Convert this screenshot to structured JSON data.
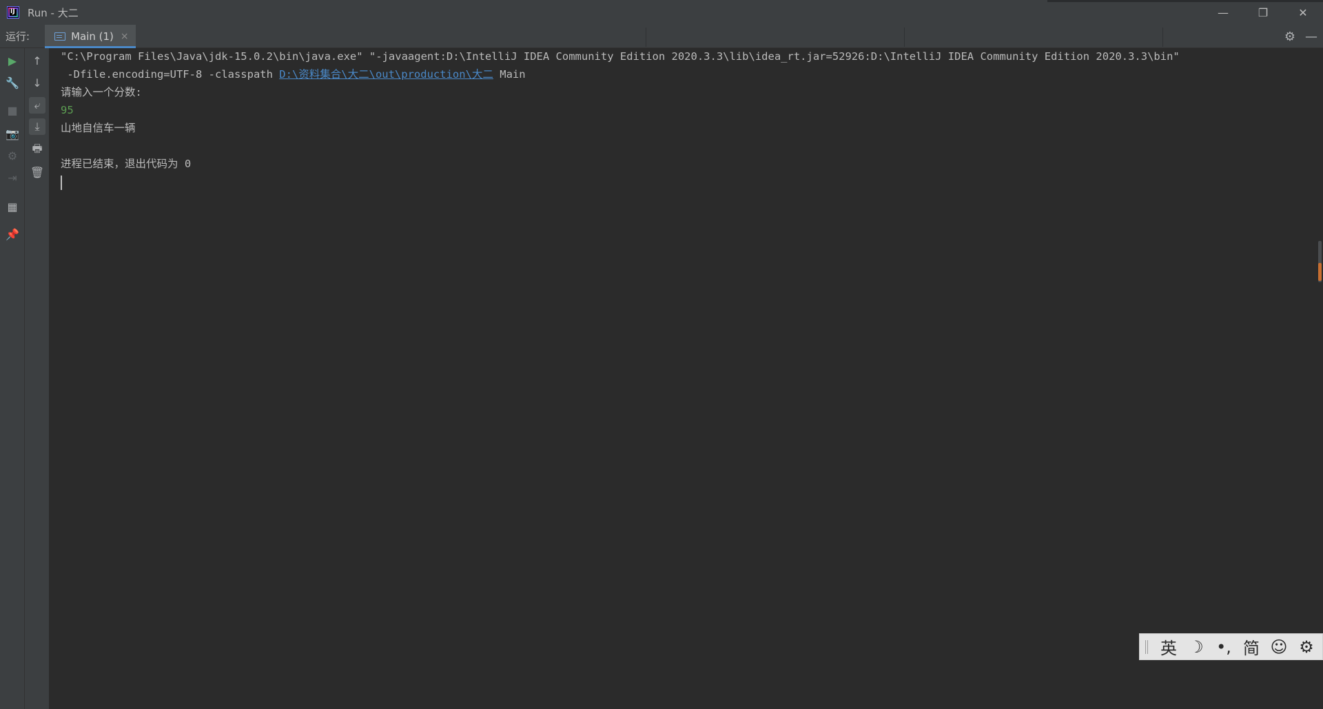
{
  "window": {
    "title": "Run - 大二",
    "logo_text": "IJ",
    "controls": {
      "minimize": "—",
      "restore": "❐",
      "close": "✕"
    }
  },
  "toolwindow": {
    "run_label": "运行:",
    "tab": {
      "label": "Main (1)",
      "close": "×"
    },
    "settings_icon": "⚙",
    "hide_icon": "—"
  },
  "left_toolbar": {
    "rerun": "▶",
    "wrench": "🔧",
    "stop": "■",
    "camera": "📷",
    "debug": "⚙",
    "exit": "⇥",
    "layout": "▦",
    "pin": "📌"
  },
  "second_toolbar": {
    "up": "↑",
    "down": "↓",
    "soft_wrap": "⤶",
    "scroll_end": "⤓",
    "print": "🖶",
    "trash": "🗑"
  },
  "console": {
    "line1": "\"C:\\Program Files\\Java\\jdk-15.0.2\\bin\\java.exe\" \"-javaagent:D:\\IntelliJ IDEA Community Edition 2020.3.3\\lib\\idea_rt.jar=52926:D:\\IntelliJ IDEA Community Edition 2020.3.3\\bin\"",
    "line2_prefix": " -Dfile.encoding=UTF-8 -classpath ",
    "line2_link": "D:\\资料集合\\大二\\out\\production\\大二",
    "line2_suffix": " Main",
    "prompt": "请输入一个分数:",
    "user_input": "95",
    "output": "山地自信车一辆",
    "exit_message": "进程已结束，退出代码为 0"
  },
  "ime": {
    "lang": "英",
    "moon": "☽",
    "punct": "•,",
    "simplified": "简",
    "emoji": "☺",
    "settings": "⚙"
  }
}
